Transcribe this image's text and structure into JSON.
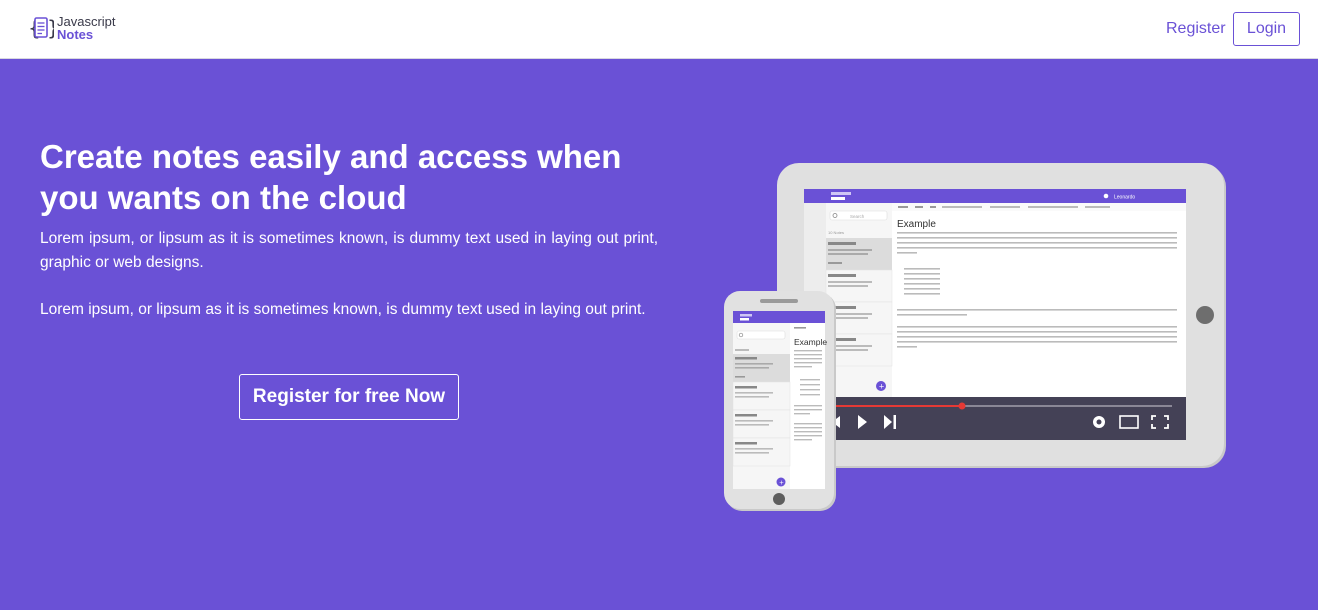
{
  "nav": {
    "logo_line1": "Javascript",
    "logo_line2": "Notes",
    "register_label": "Register",
    "login_label": "Login"
  },
  "hero": {
    "title": "Create notes easily and access when you wants on the cloud",
    "paragraph1": "Lorem ipsum, or lipsum as it is sometimes known, is dummy text used in laying out print, graphic or web designs.",
    "paragraph2": "Lorem ipsum, or lipsum as it is sometimes known, is dummy text used in laying out print.",
    "cta_label": "Register for free Now"
  },
  "illustration": {
    "tablet_user": "Leonardo",
    "note_heading": "Example",
    "search_placeholder": "Search",
    "notes_count_label": "10 Notes"
  },
  "colors": {
    "brand": "#6a51d6",
    "white": "#ffffff",
    "video_bar": "#444156",
    "progress": "#e53935"
  }
}
